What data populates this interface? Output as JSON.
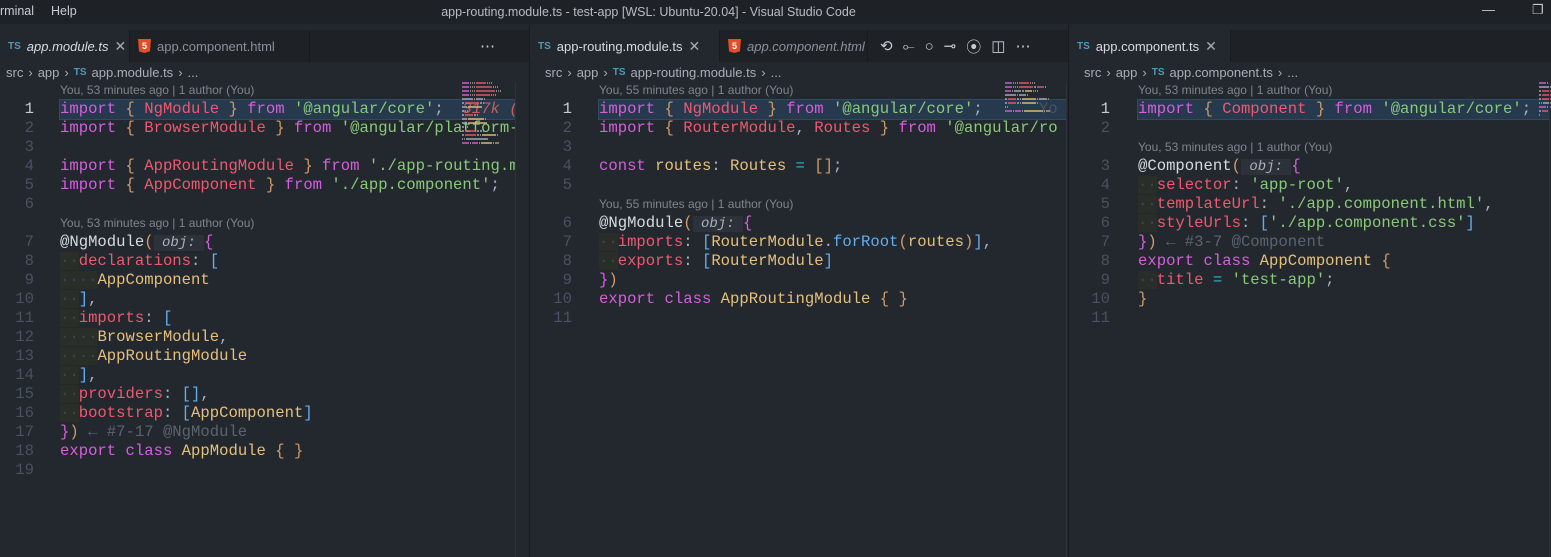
{
  "titlebar": {
    "menu": [
      "rminal",
      "Help"
    ],
    "title": "app-routing.module.ts - test-app [WSL: Ubuntu-20.04] - Visual Studio Code",
    "minimize": "—",
    "restore": "❐"
  },
  "panes": [
    {
      "tabs": [
        {
          "icon": "TS",
          "label": "app.module.ts",
          "active": true,
          "italic": true,
          "close": "✕"
        },
        {
          "icon": "5",
          "label": "app.component.html",
          "active": false,
          "italic": false
        }
      ],
      "actions": [
        "⋯"
      ],
      "breadcrumb": [
        "src",
        "app",
        "app.module.ts",
        "..."
      ],
      "rows": [
        {
          "lens": "You, 53 minutes ago | 1 author (You)"
        },
        {
          "n": "1",
          "cur": true,
          "tok": [
            [
              "import",
              "k"
            ],
            [
              " "
            ],
            [
              "{",
              "b1"
            ],
            [
              " "
            ],
            [
              "NgModule",
              "c"
            ],
            [
              " "
            ],
            [
              "}",
              "b1"
            ],
            [
              " "
            ],
            [
              "from",
              "k"
            ],
            [
              " "
            ],
            [
              "'@angular/core'",
              "s"
            ],
            [
              ";",
              "p"
            ],
            [
              "  317k (",
              "cost"
            ]
          ]
        },
        {
          "n": "2",
          "tok": [
            [
              "import",
              "k"
            ],
            [
              " "
            ],
            [
              "{",
              "b1"
            ],
            [
              " "
            ],
            [
              "BrowserModule",
              "c"
            ],
            [
              " "
            ],
            [
              "}",
              "b1"
            ],
            [
              " "
            ],
            [
              "from",
              "k"
            ],
            [
              " "
            ],
            [
              "'@angular/platform-",
              "s"
            ]
          ]
        },
        {
          "n": "3",
          "tok": []
        },
        {
          "n": "4",
          "tok": [
            [
              "import",
              "k"
            ],
            [
              " "
            ],
            [
              "{",
              "b1"
            ],
            [
              " "
            ],
            [
              "AppRoutingModule",
              "c"
            ],
            [
              " "
            ],
            [
              "}",
              "b1"
            ],
            [
              " "
            ],
            [
              "from",
              "k"
            ],
            [
              " "
            ],
            [
              "'./app-routing.m",
              "s"
            ]
          ]
        },
        {
          "n": "5",
          "tok": [
            [
              "import",
              "k"
            ],
            [
              " "
            ],
            [
              "{",
              "b1"
            ],
            [
              " "
            ],
            [
              "AppComponent",
              "c"
            ],
            [
              " "
            ],
            [
              "}",
              "b1"
            ],
            [
              " "
            ],
            [
              "from",
              "k"
            ],
            [
              " "
            ],
            [
              "'./app.component'",
              "s"
            ],
            [
              ";",
              "p"
            ]
          ]
        },
        {
          "n": "6",
          "tok": []
        },
        {
          "lens": "You, 53 minutes ago | 1 author (You)"
        },
        {
          "n": "7",
          "tok": [
            [
              "@NgModule",
              "d"
            ],
            [
              "(",
              "b1"
            ],
            [
              " obj: ",
              "h"
            ],
            [
              "{",
              "b2"
            ]
          ]
        },
        {
          "n": "8",
          "tok": [
            [
              "··",
              "ws"
            ],
            [
              "declarations",
              "prop"
            ],
            [
              ": ",
              "p"
            ],
            [
              "[",
              "b3"
            ]
          ]
        },
        {
          "n": "9",
          "tok": [
            [
              "····",
              "ws"
            ],
            [
              "AppComponent",
              "t"
            ]
          ]
        },
        {
          "n": "10",
          "tok": [
            [
              "··",
              "ws"
            ],
            [
              "]",
              "b3"
            ],
            [
              ",",
              "p"
            ]
          ]
        },
        {
          "n": "11",
          "tok": [
            [
              "··",
              "ws"
            ],
            [
              "imports",
              "prop"
            ],
            [
              ": ",
              "p"
            ],
            [
              "[",
              "b3"
            ]
          ]
        },
        {
          "n": "12",
          "tok": [
            [
              "····",
              "ws"
            ],
            [
              "BrowserModule",
              "t"
            ],
            [
              ",",
              "p"
            ]
          ]
        },
        {
          "n": "13",
          "tok": [
            [
              "····",
              "ws"
            ],
            [
              "AppRoutingModule",
              "t"
            ]
          ]
        },
        {
          "n": "14",
          "tok": [
            [
              "··",
              "ws"
            ],
            [
              "]",
              "b3"
            ],
            [
              ",",
              "p"
            ]
          ]
        },
        {
          "n": "15",
          "tok": [
            [
              "··",
              "ws"
            ],
            [
              "providers",
              "prop"
            ],
            [
              ": ",
              "p"
            ],
            [
              "[]",
              "b3"
            ],
            [
              ",",
              "p"
            ]
          ]
        },
        {
          "n": "16",
          "tok": [
            [
              "··",
              "ws"
            ],
            [
              "bootstrap",
              "prop"
            ],
            [
              ": ",
              "p"
            ],
            [
              "[",
              "b3"
            ],
            [
              "AppComponent",
              "t"
            ],
            [
              "]",
              "b3"
            ]
          ]
        },
        {
          "n": "17",
          "tok": [
            [
              "}",
              "b2"
            ],
            [
              ")",
              "b1"
            ],
            [
              " ← #7-17 @NgModule",
              "cm"
            ]
          ]
        },
        {
          "n": "18",
          "tok": [
            [
              "export",
              "k"
            ],
            [
              " "
            ],
            [
              "class",
              "k"
            ],
            [
              " "
            ],
            [
              "AppModule",
              "t"
            ],
            [
              " "
            ],
            [
              "{ }",
              "b1"
            ]
          ]
        },
        {
          "n": "19",
          "tok": []
        }
      ]
    },
    {
      "tabs": [
        {
          "icon": "TS",
          "label": "app-routing.module.ts",
          "active": true,
          "italic": false,
          "close": "✕"
        },
        {
          "icon": "5",
          "label": "app.component.html",
          "active": false,
          "italic": true
        }
      ],
      "actions": [
        "⟲",
        "⟜",
        "○",
        "⊸",
        "⦿",
        "◫",
        "⋯"
      ],
      "breadcrumb": [
        "src",
        "app",
        "app-routing.module.ts",
        "..."
      ],
      "rows": [
        {
          "lens": "You, 55 minutes ago | 1 author (You)"
        },
        {
          "n": "1",
          "cur": true,
          "tok": [
            [
              "import",
              "k"
            ],
            [
              " "
            ],
            [
              "{",
              "b1"
            ],
            [
              " "
            ],
            [
              "NgModule",
              "c"
            ],
            [
              " "
            ],
            [
              "}",
              "b1"
            ],
            [
              " "
            ],
            [
              "from",
              "k"
            ],
            [
              " "
            ],
            [
              "'@angular/core'",
              "s"
            ],
            [
              ";",
              "p"
            ],
            [
              "      Yo",
              "blame"
            ]
          ]
        },
        {
          "n": "2",
          "tok": [
            [
              "import",
              "k"
            ],
            [
              " "
            ],
            [
              "{",
              "b1"
            ],
            [
              " "
            ],
            [
              "RouterModule",
              "c"
            ],
            [
              ", ",
              "p"
            ],
            [
              "Routes",
              "c"
            ],
            [
              " "
            ],
            [
              "}",
              "b1"
            ],
            [
              " "
            ],
            [
              "from",
              "k"
            ],
            [
              " "
            ],
            [
              "'@angular/ro",
              "s"
            ]
          ]
        },
        {
          "n": "3",
          "tok": []
        },
        {
          "n": "4",
          "tok": [
            [
              "const",
              "k"
            ],
            [
              " "
            ],
            [
              "routes",
              "v"
            ],
            [
              ": ",
              "p"
            ],
            [
              "Routes",
              "t"
            ],
            [
              " "
            ],
            [
              "=",
              "o"
            ],
            [
              " "
            ],
            [
              "[]",
              "b1"
            ],
            [
              ";",
              "p"
            ]
          ]
        },
        {
          "n": "5",
          "tok": []
        },
        {
          "lens": "You, 55 minutes ago | 1 author (You)"
        },
        {
          "n": "6",
          "tok": [
            [
              "@NgModule",
              "d"
            ],
            [
              "(",
              "b1"
            ],
            [
              " obj: ",
              "h"
            ],
            [
              "{",
              "b2"
            ]
          ]
        },
        {
          "n": "7",
          "tok": [
            [
              "··",
              "ws"
            ],
            [
              "imports",
              "prop"
            ],
            [
              ": ",
              "p"
            ],
            [
              "[",
              "b3"
            ],
            [
              "RouterModule",
              "t"
            ],
            [
              ".",
              "p"
            ],
            [
              "forRoot",
              "f"
            ],
            [
              "(",
              "b1"
            ],
            [
              "routes",
              "v"
            ],
            [
              ")",
              "b1"
            ],
            [
              "]",
              "b3"
            ],
            [
              ",",
              "p"
            ]
          ]
        },
        {
          "n": "8",
          "tok": [
            [
              "··",
              "ws"
            ],
            [
              "exports",
              "prop"
            ],
            [
              ": ",
              "p"
            ],
            [
              "[",
              "b3"
            ],
            [
              "RouterModule",
              "t"
            ],
            [
              "]",
              "b3"
            ]
          ]
        },
        {
          "n": "9",
          "tok": [
            [
              "}",
              "b2"
            ],
            [
              ")",
              "b1"
            ]
          ]
        },
        {
          "n": "10",
          "tok": [
            [
              "export",
              "k"
            ],
            [
              " "
            ],
            [
              "class",
              "k"
            ],
            [
              " "
            ],
            [
              "AppRoutingModule",
              "t"
            ],
            [
              " "
            ],
            [
              "{ }",
              "b1"
            ]
          ]
        },
        {
          "n": "11",
          "tok": []
        }
      ]
    },
    {
      "tabs": [
        {
          "icon": "TS",
          "label": "app.component.ts",
          "active": true,
          "italic": false,
          "close": "✕"
        }
      ],
      "actions": [],
      "breadcrumb": [
        "src",
        "app",
        "app.component.ts",
        "..."
      ],
      "rows": [
        {
          "lens": "You, 53 minutes ago | 1 author (You)"
        },
        {
          "n": "1",
          "cur": true,
          "tok": [
            [
              "import",
              "k"
            ],
            [
              " "
            ],
            [
              "{",
              "b1"
            ],
            [
              " "
            ],
            [
              "Component",
              "c"
            ],
            [
              " "
            ],
            [
              "}",
              "b1"
            ],
            [
              " "
            ],
            [
              "from",
              "k"
            ],
            [
              " "
            ],
            [
              "'@angular/core'",
              "s"
            ],
            [
              ";",
              "p"
            ]
          ]
        },
        {
          "n": "2",
          "tok": []
        },
        {
          "lens": "You, 53 minutes ago | 1 author (You)"
        },
        {
          "n": "3",
          "tok": [
            [
              "@Component",
              "d"
            ],
            [
              "(",
              "b1"
            ],
            [
              " obj: ",
              "h"
            ],
            [
              "{",
              "b2"
            ]
          ]
        },
        {
          "n": "4",
          "tok": [
            [
              "··",
              "ws"
            ],
            [
              "selector",
              "prop"
            ],
            [
              ": ",
              "p"
            ],
            [
              "'app-root'",
              "s"
            ],
            [
              ",",
              "p"
            ]
          ]
        },
        {
          "n": "5",
          "tok": [
            [
              "··",
              "ws"
            ],
            [
              "templateUrl",
              "prop"
            ],
            [
              ": ",
              "p"
            ],
            [
              "'./app.component.html'",
              "s"
            ],
            [
              ",",
              "p"
            ]
          ]
        },
        {
          "n": "6",
          "tok": [
            [
              "··",
              "ws"
            ],
            [
              "styleUrls",
              "prop"
            ],
            [
              ": ",
              "p"
            ],
            [
              "[",
              "b3"
            ],
            [
              "'./app.component.css'",
              "s"
            ],
            [
              "]",
              "b3"
            ]
          ]
        },
        {
          "n": "7",
          "tok": [
            [
              "}",
              "b2"
            ],
            [
              ")",
              "b1"
            ],
            [
              " ← #3-7 @Component",
              "cm"
            ]
          ]
        },
        {
          "n": "8",
          "tok": [
            [
              "export",
              "k"
            ],
            [
              " "
            ],
            [
              "class",
              "k"
            ],
            [
              " "
            ],
            [
              "AppComponent",
              "t"
            ],
            [
              " "
            ],
            [
              "{",
              "b1"
            ]
          ]
        },
        {
          "n": "9",
          "tok": [
            [
              "··",
              "ws"
            ],
            [
              "title",
              "prop"
            ],
            [
              " "
            ],
            [
              "=",
              "o"
            ],
            [
              " "
            ],
            [
              "'test-app'",
              "s"
            ],
            [
              ";",
              "p"
            ]
          ]
        },
        {
          "n": "10",
          "tok": [
            [
              "}",
              "b1"
            ]
          ]
        },
        {
          "n": "11",
          "tok": []
        }
      ]
    }
  ]
}
